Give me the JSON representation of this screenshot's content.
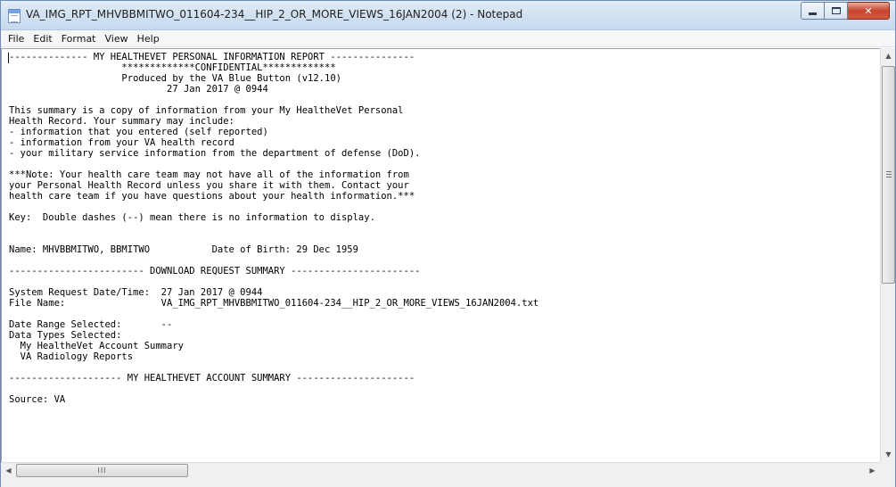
{
  "window": {
    "title": "VA_IMG_RPT_MHVBBMITWO_011604-234__HIP_2_OR_MORE_VIEWS_16JAN2004 (2) - Notepad",
    "controls": {
      "minimize": "",
      "maximize": "",
      "close": "✕"
    }
  },
  "menu": [
    "File",
    "Edit",
    "Format",
    "View",
    "Help"
  ],
  "document": {
    "lines": [
      "-------------- MY HEALTHEVET PERSONAL INFORMATION REPORT ---------------",
      "                    *************CONFIDENTIAL*************",
      "                    Produced by the VA Blue Button (v12.10)",
      "                            27 Jan 2017 @ 0944",
      "",
      "This summary is a copy of information from your My HealtheVet Personal",
      "Health Record. Your summary may include:",
      "- information that you entered (self reported)",
      "- information from your VA health record",
      "- your military service information from the department of defense (DoD).",
      "",
      "***Note: Your health care team may not have all of the information from",
      "your Personal Health Record unless you share it with them. Contact your",
      "health care team if you have questions about your health information.***",
      "",
      "Key:  Double dashes (--) mean there is no information to display.",
      "",
      "",
      "Name: MHVBBMITWO, BBMITWO           Date of Birth: 29 Dec 1959",
      "",
      "------------------------ DOWNLOAD REQUEST SUMMARY -----------------------",
      "",
      "System Request Date/Time:  27 Jan 2017 @ 0944",
      "File Name:                 VA_IMG_RPT_MHVBBMITWO_011604-234__HIP_2_OR_MORE_VIEWS_16JAN2004.txt",
      "",
      "Date Range Selected:       --",
      "Data Types Selected:",
      "  My HealtheVet Account Summary",
      "  VA Radiology Reports",
      "",
      "-------------------- MY HEALTHEVET ACCOUNT SUMMARY ---------------------",
      "",
      "Source: VA"
    ]
  },
  "scrollbars": {
    "vertical": {
      "up_arrow": "▲",
      "down_arrow": "▼"
    },
    "horizontal": {
      "left_arrow": "◀",
      "right_arrow": "▶",
      "thumb_grip": "III"
    }
  }
}
